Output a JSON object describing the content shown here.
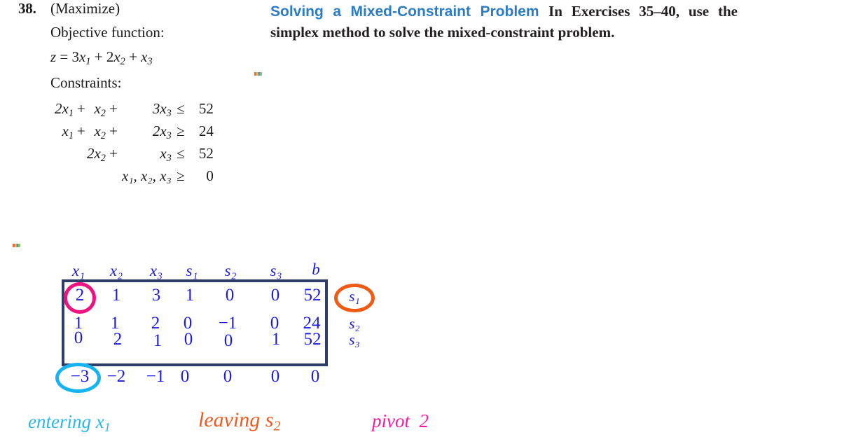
{
  "exercise": {
    "number": "38.",
    "maximize": "(Maximize)",
    "objective_label": "Objective function:",
    "objective_equation": {
      "lhs": "z",
      "eq": "=",
      "term1_coef": "3",
      "term1_var": "x",
      "term1_sub": "1",
      "plus1": "+",
      "term2_coef": "2",
      "term2_var": "x",
      "term2_sub": "2",
      "plus2": "+",
      "term3_coef": "",
      "term3_var": "x",
      "term3_sub": "3"
    },
    "constraints_label": "Constraints:",
    "constraints": [
      {
        "t1": "2x",
        "t1sub": "1",
        "op": "+",
        "t2": "x",
        "t2sub": "2",
        "op2": "+",
        "t3": "3x",
        "t3sub": "3",
        "rel": "≤",
        "rhs": "52"
      },
      {
        "t1": "x",
        "t1sub": "1",
        "op": "+",
        "t2": "x",
        "t2sub": "2",
        "op2": "+",
        "t3": "2x",
        "t3sub": "3",
        "rel": "≥",
        "rhs": "24"
      },
      {
        "t1": "",
        "t1sub": "",
        "op": "",
        "t2": "2x",
        "t2sub": "2",
        "op2": "+",
        "t3": "x",
        "t3sub": "3",
        "rel": "≤",
        "rhs": "52"
      },
      {
        "t1": "",
        "t1sub": "",
        "op": "",
        "t2": "",
        "t2sub": "",
        "op2": "",
        "t3": "x₁, x₂, x₃",
        "t3sub": "",
        "rel": "≥",
        "rhs": "0"
      }
    ]
  },
  "instruction": {
    "title": "Solving a Mixed-Constraint Problem",
    "body": "In Exercises 35–40, use the simplex method to solve the mixed-constraint problem."
  },
  "tableau": {
    "column_headers": [
      "x₁",
      "x₂",
      "x₃",
      "s₁",
      "s₂",
      "s₃",
      "b"
    ],
    "rows": [
      {
        "values": [
          "2",
          "1",
          "3",
          "1",
          "0",
          "0",
          "52"
        ],
        "basis": "s₁"
      },
      {
        "values": [
          "1",
          "1",
          "2",
          "0",
          "−1",
          "0",
          "24"
        ],
        "basis": "s₂"
      },
      {
        "values": [
          "0",
          "2",
          "1",
          "0",
          "0",
          "1",
          "52"
        ],
        "basis": "s₃"
      }
    ],
    "objective_row": [
      "−3",
      "−2",
      "−1",
      "0",
      "0",
      "0",
      "0"
    ],
    "colors": {
      "numbers": "#1a1ae6",
      "box_border": "#2f3d6b",
      "pivot_circle": "#f0137f",
      "leaving_circle": "#ef5a14",
      "entering_circle": "#17b3f0"
    }
  },
  "annotations": {
    "entering": {
      "text": "entering x",
      "sub": "1",
      "color": "#29b6f2"
    },
    "leaving": {
      "text": "leaving s",
      "sub": "2",
      "color": "#f2581c"
    },
    "pivot": {
      "text": "pivot",
      "value": "2",
      "color": "#f71aa0"
    }
  }
}
